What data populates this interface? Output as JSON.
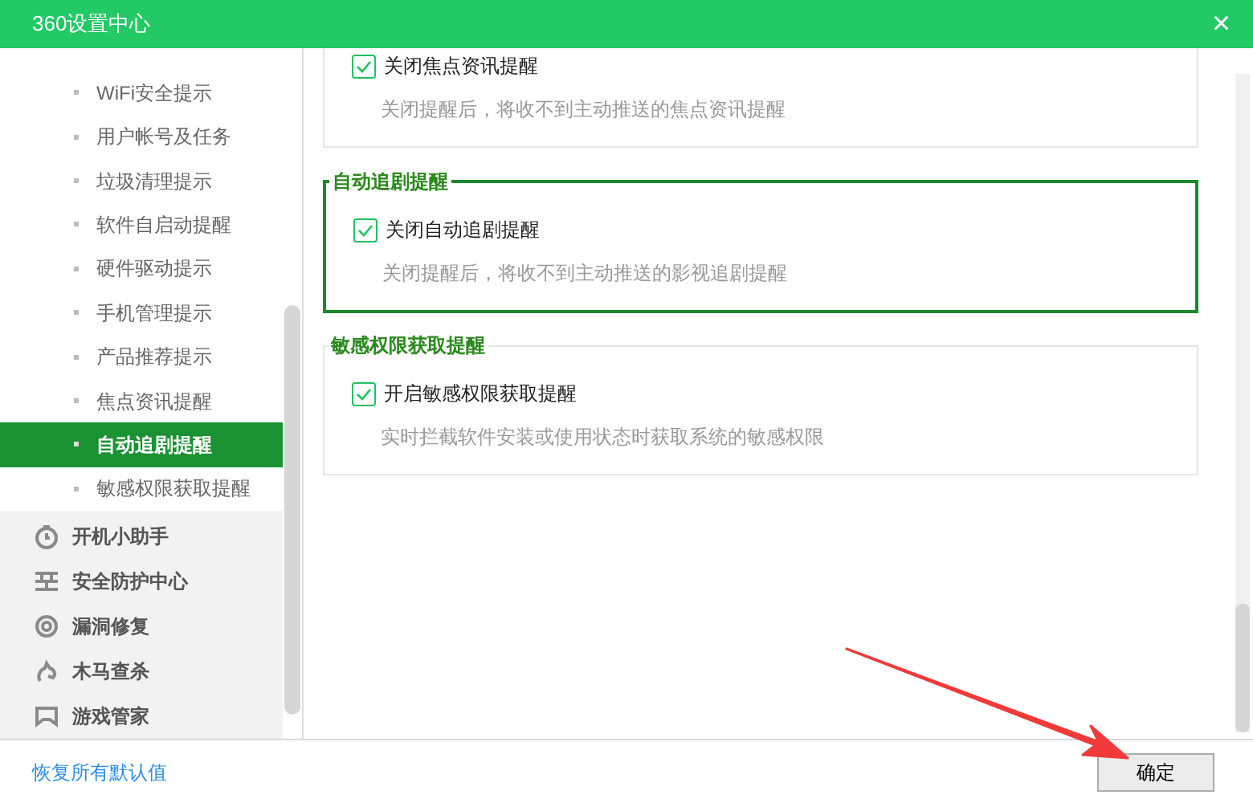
{
  "window": {
    "title": "360设置中心",
    "close": "×"
  },
  "sidebar": {
    "sub_items": [
      {
        "label": "WiFi安全提示",
        "selected": false
      },
      {
        "label": "用户帐号及任务",
        "selected": false
      },
      {
        "label": "垃圾清理提示",
        "selected": false
      },
      {
        "label": "软件自启动提醒",
        "selected": false
      },
      {
        "label": "硬件驱动提示",
        "selected": false
      },
      {
        "label": "手机管理提示",
        "selected": false
      },
      {
        "label": "产品推荐提示",
        "selected": false
      },
      {
        "label": "焦点资讯提醒",
        "selected": false
      },
      {
        "label": "自动追剧提醒",
        "selected": true
      },
      {
        "label": "敏感权限获取提醒",
        "selected": false
      }
    ],
    "sections": [
      {
        "label": "开机小助手",
        "kind": "timer"
      },
      {
        "label": "安全防护中心",
        "kind": "shield"
      },
      {
        "label": "漏洞修复",
        "kind": "repair"
      },
      {
        "label": "木马查杀",
        "kind": "horse"
      },
      {
        "label": "游戏管家",
        "kind": "game"
      }
    ]
  },
  "groups": [
    {
      "highlighted": false,
      "option": {
        "label": "关闭焦点资讯提醒",
        "checked": true
      },
      "description": "关闭提醒后，将收不到主动推送的焦点资讯提醒"
    },
    {
      "title": "自动追剧提醒",
      "highlighted": true,
      "option": {
        "label": "关闭自动追剧提醒",
        "checked": true
      },
      "description": "关闭提醒后，将收不到主动推送的影视追剧提醒"
    },
    {
      "title": "敏感权限获取提醒",
      "highlighted": false,
      "option": {
        "label": "开启敏感权限获取提醒",
        "checked": true
      },
      "description": "实时拦截软件安装或使用状态时获取系统的敏感权限"
    }
  ],
  "footer": {
    "restore_link": "恢复所有默认值",
    "ok_button": "确定"
  }
}
